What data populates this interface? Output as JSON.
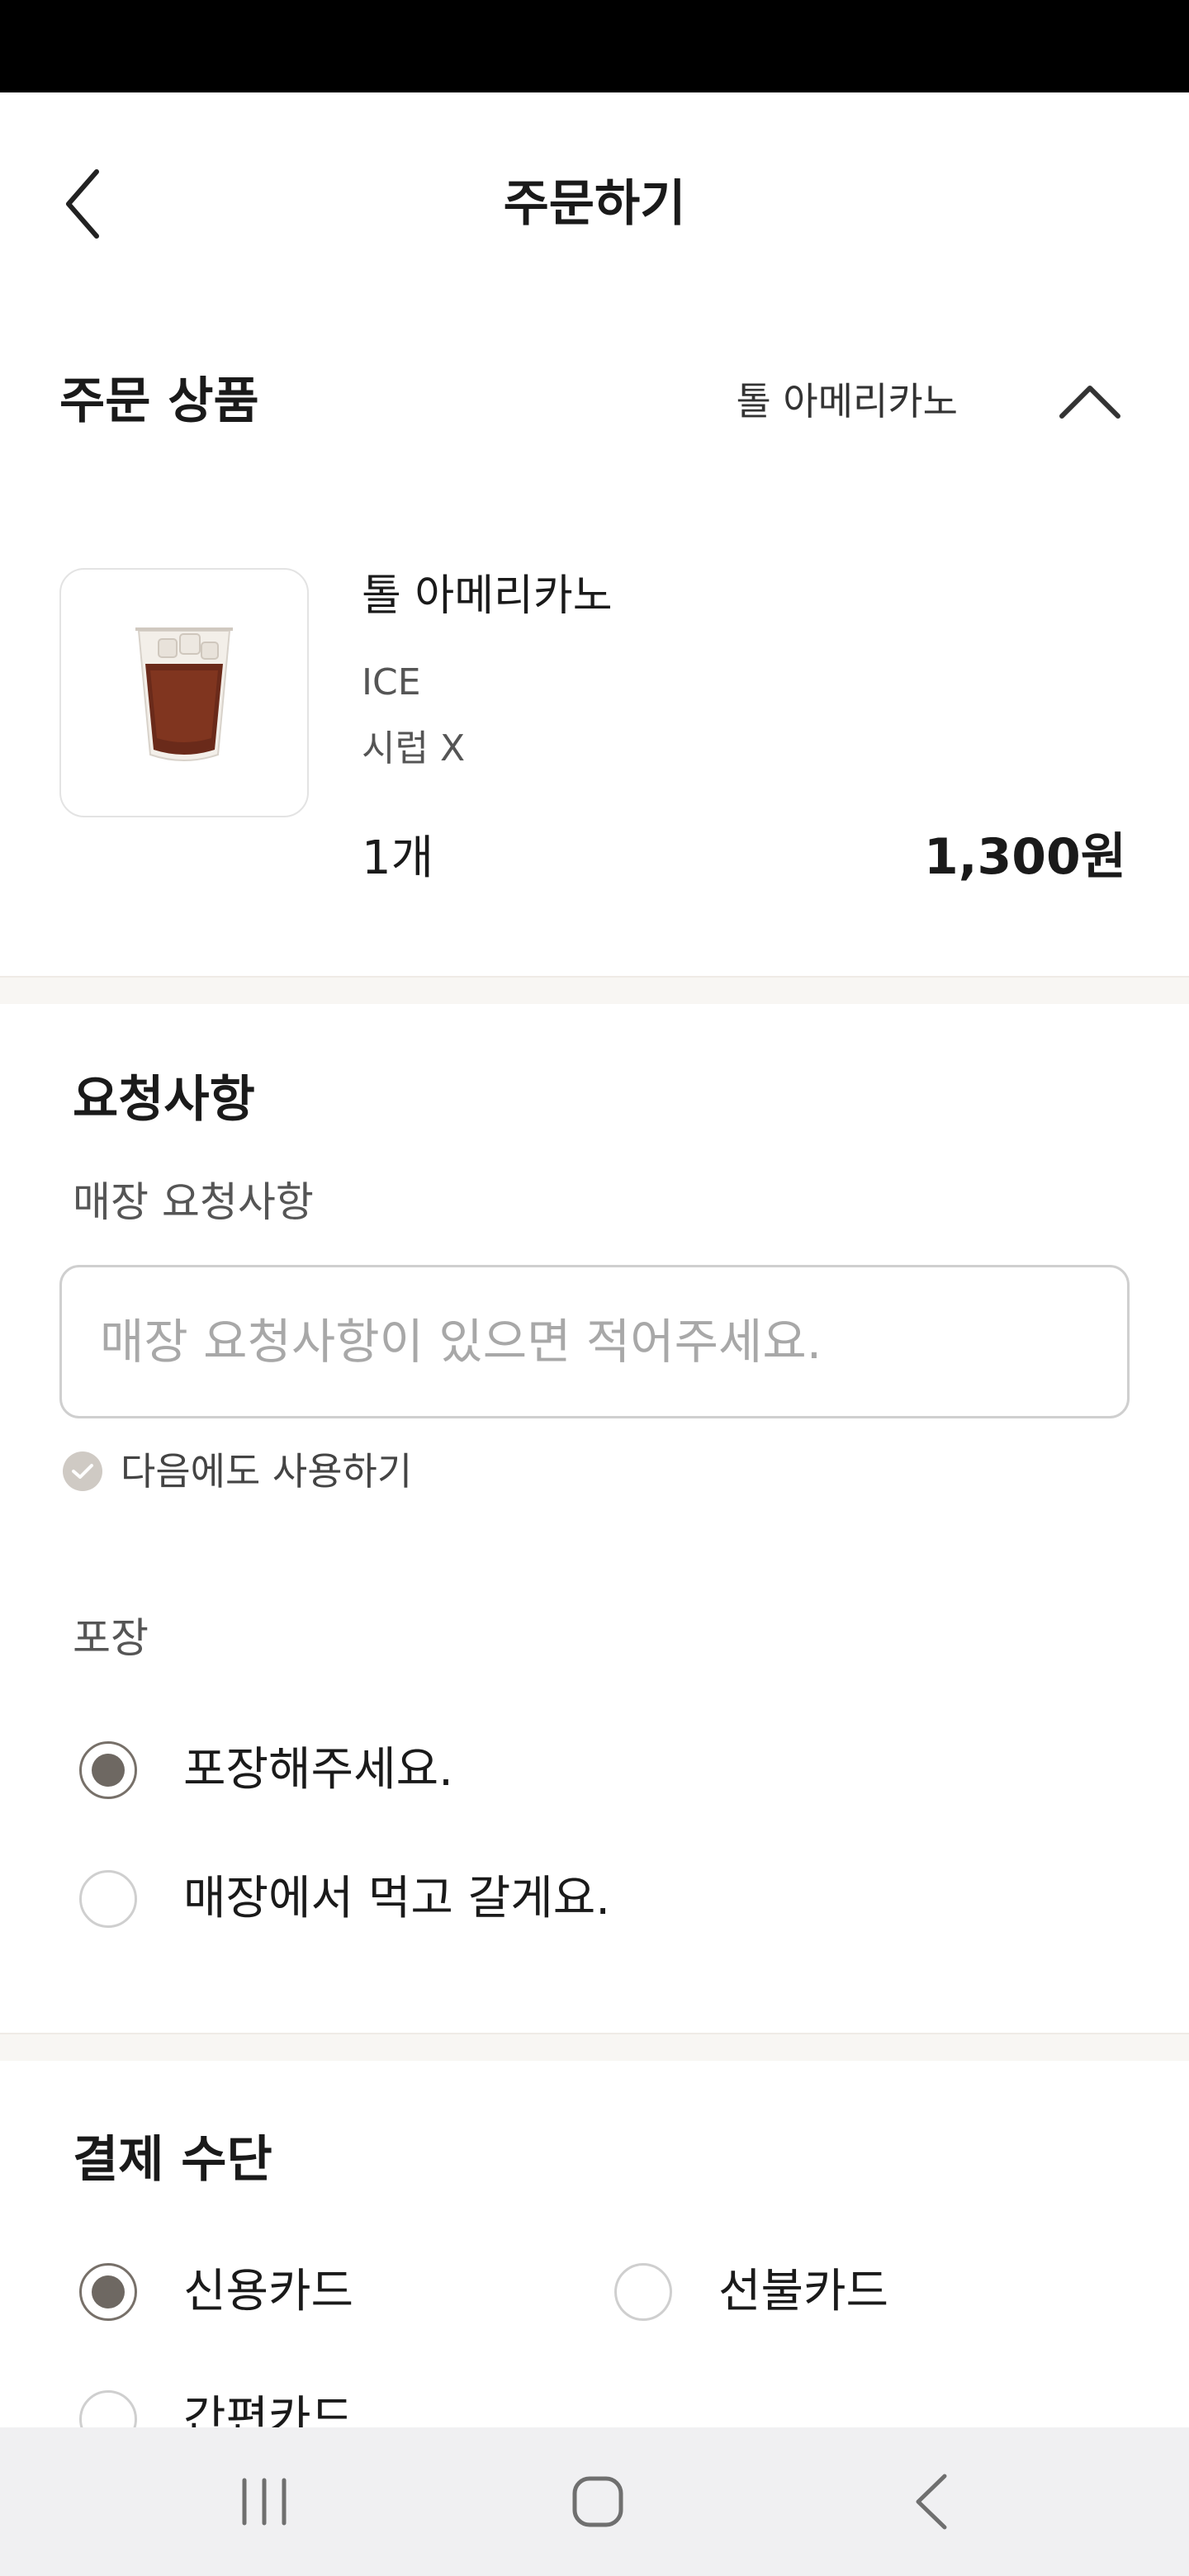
{
  "header": {
    "title": "주문하기"
  },
  "order_items": {
    "section_title": "주문 상품",
    "summary_name": "톨 아메리카노",
    "items": [
      {
        "name": "톨 아메리카노",
        "options": [
          "ICE",
          "시럽 X"
        ],
        "quantity": "1개",
        "price": "1,300원"
      }
    ]
  },
  "requests": {
    "section_title": "요청사항",
    "store_label": "매장 요청사항",
    "store_placeholder": "매장 요청사항이 있으면 적어주세요.",
    "store_value": "",
    "save_next_label": "다음에도 사용하기",
    "save_next_checked": true,
    "packaging_label": "포장",
    "packaging_options": [
      {
        "label": "포장해주세요.",
        "selected": true
      },
      {
        "label": "매장에서 먹고 갈게요.",
        "selected": false
      }
    ]
  },
  "payment": {
    "section_title": "결제 수단",
    "methods": [
      {
        "label": "신용카드",
        "selected": true
      },
      {
        "label": "선불카드",
        "selected": false
      },
      {
        "label": "간편카드",
        "selected": false
      }
    ]
  },
  "colors": {
    "accent": "#6e6862",
    "divider": "#f8f6f3",
    "nav_bar": "#f0f0f2"
  },
  "icons": {
    "back": "chevron-left-icon",
    "collapse": "chevron-up-icon",
    "check": "check-icon",
    "nav_recents": "recents-icon",
    "nav_home": "home-icon",
    "nav_back": "nav-back-icon"
  }
}
